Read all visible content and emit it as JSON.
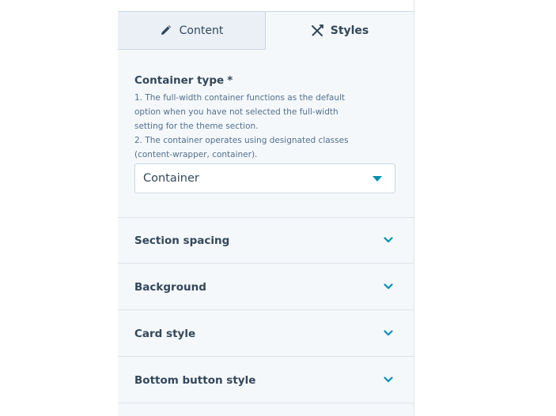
{
  "tabs": {
    "content_label": "Content",
    "styles_label": "Styles"
  },
  "container_type": {
    "label": "Container type",
    "required_mark": "*",
    "help_lines": [
      "1. The full-width container functions as the default",
      "option when you have not selected the full-width",
      "setting for the theme section.",
      "2. The container operates using designated classes",
      "(content-wrapper, container)."
    ],
    "selected_value": "Container"
  },
  "accordion": [
    {
      "label": "Section spacing"
    },
    {
      "label": "Background"
    },
    {
      "label": "Card style"
    },
    {
      "label": "Bottom button style"
    }
  ],
  "colors": {
    "accent": "#0091ae",
    "text": "#33475b",
    "panel_bg": "#f5f8fa",
    "tab_inactive_bg": "#eaf0f6"
  },
  "icons": {
    "content_tab": "pencil-icon",
    "styles_tab": "styles-icon",
    "select_caret": "caret-down-icon",
    "accordion": "chevron-down-icon"
  }
}
